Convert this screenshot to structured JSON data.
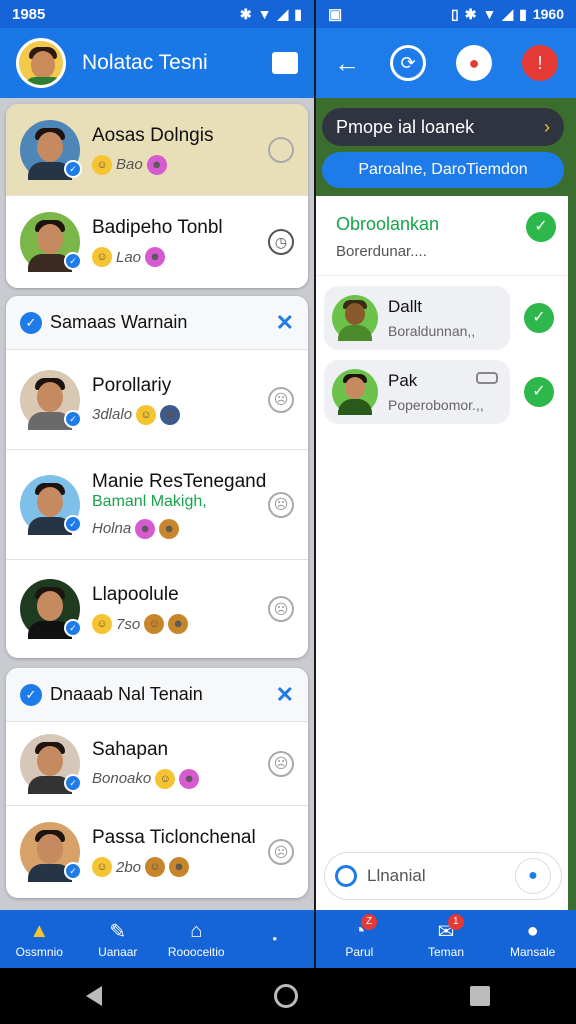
{
  "left": {
    "status_time": "1985",
    "appbar_title": "Nolatac Tesni",
    "top_card": [
      {
        "name": "Aosas Dolngis",
        "meta": "Bao"
      },
      {
        "name": "Badipeho Tonbl",
        "meta": "Lao"
      }
    ],
    "group1": {
      "title": "Samaas Warnain",
      "rows": [
        {
          "name": "Porollariy",
          "sub": "",
          "meta": "3dlalo"
        },
        {
          "name": "Manie ResTenegand",
          "sub": "Bamanl Makigh,",
          "meta": "Holna"
        },
        {
          "name": "Llapoolule",
          "sub": "",
          "meta": "7so"
        }
      ]
    },
    "group2": {
      "title": "Dnaaab Nal Tenain",
      "rows": [
        {
          "name": "Sahapan",
          "sub": "",
          "meta": "Bonoako"
        },
        {
          "name": "Passa Ticlonchenal",
          "sub": "",
          "meta": "2bo"
        }
      ]
    },
    "nav": [
      {
        "label": "Ossmnio",
        "icon": "bell-icon"
      },
      {
        "label": "Uanaar",
        "icon": "chat-bubble-icon"
      },
      {
        "label": "Roooceitio",
        "icon": "home-icon"
      },
      {
        "label": "",
        "icon": "dot-icon"
      }
    ]
  },
  "right": {
    "status_time": "1960",
    "banner": "Pmope ial loanek",
    "pill": "Paroalne, DaroTiemdon",
    "panel_head": {
      "title": "Obroolankan",
      "sub": "Borerdunar...."
    },
    "messages": [
      {
        "name": "Dallt",
        "sub": "Boraldunnan,,"
      },
      {
        "name": "Pak",
        "sub": "Poperobomor.,,"
      }
    ],
    "input_placeholder": "Llnanial",
    "nav": [
      {
        "label": "Parul",
        "badge": "Z"
      },
      {
        "label": "Teman",
        "badge": "1"
      },
      {
        "label": "Mansale",
        "badge": ""
      }
    ]
  },
  "colors": {
    "primary": "#1565d8",
    "accent": "#1e7bea",
    "green": "#2eb84b",
    "red": "#e53935",
    "banner": "#2f3440"
  }
}
